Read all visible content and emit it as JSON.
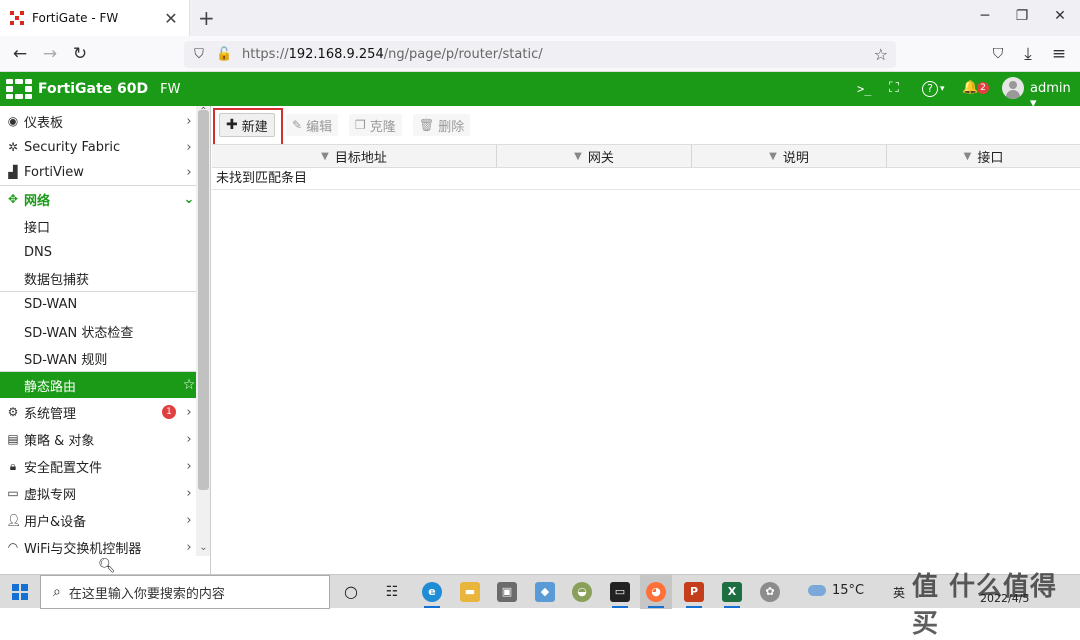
{
  "browser": {
    "tab_title": "FortiGate - FW",
    "tab_close": "✕",
    "new_tab": "+",
    "win_minimize": "─",
    "win_restore": "❐",
    "win_close": "✕",
    "url_prefix": "https://",
    "url_host": "192.168.9.254",
    "url_path": "/ng/page/p/router/static/"
  },
  "header": {
    "product": "FortiGate 60D",
    "hostname": "FW",
    "cli_glyph": ">_",
    "fullscreen_glyph": "⛶",
    "help_glyph": "?",
    "bell_glyph": "🔔",
    "notification_count": "2",
    "user": "admin"
  },
  "sidebar": {
    "items": [
      {
        "label": "仪表板",
        "icon": "dashboard-icon"
      },
      {
        "label": "Security Fabric",
        "icon": "fabric-icon"
      },
      {
        "label": "FortiView",
        "icon": "chart-icon"
      },
      {
        "label": "网络",
        "icon": "network-icon",
        "state": "expanded"
      },
      {
        "label": "接口"
      },
      {
        "label": "DNS"
      },
      {
        "label": "数据包捕获"
      },
      {
        "label": "SD-WAN"
      },
      {
        "label": "SD-WAN 状态检查"
      },
      {
        "label": "SD-WAN 规则"
      },
      {
        "label": "静态路由",
        "state": "active"
      },
      {
        "label": "系统管理",
        "icon": "gear-icon",
        "badge": "1"
      },
      {
        "label": "策略 & 对象",
        "icon": "policy-icon"
      },
      {
        "label": "安全配置文件",
        "icon": "lock-icon"
      },
      {
        "label": "虚拟专网",
        "icon": "laptop-icon"
      },
      {
        "label": "用户&设备",
        "icon": "user-icon"
      },
      {
        "label": "WiFi与交换机控制器",
        "icon": "wifi-icon"
      }
    ]
  },
  "toolbar": {
    "new_label": "新建",
    "edit_label": "编辑",
    "clone_label": "克隆",
    "delete_label": "删除"
  },
  "table": {
    "columns": [
      "目标地址",
      "网关",
      "说明",
      "接口"
    ],
    "empty_message": "未找到匹配条目"
  },
  "taskbar": {
    "search_placeholder": "在这里输入你要搜索的内容",
    "temperature": "15°C",
    "ime": "英",
    "date": "2022/4/5",
    "watermark": "值 什么值得买"
  },
  "colors": {
    "brand_green": "#1a9a17",
    "highlight_red": "#d32f2f",
    "badge_red": "#e04040"
  }
}
